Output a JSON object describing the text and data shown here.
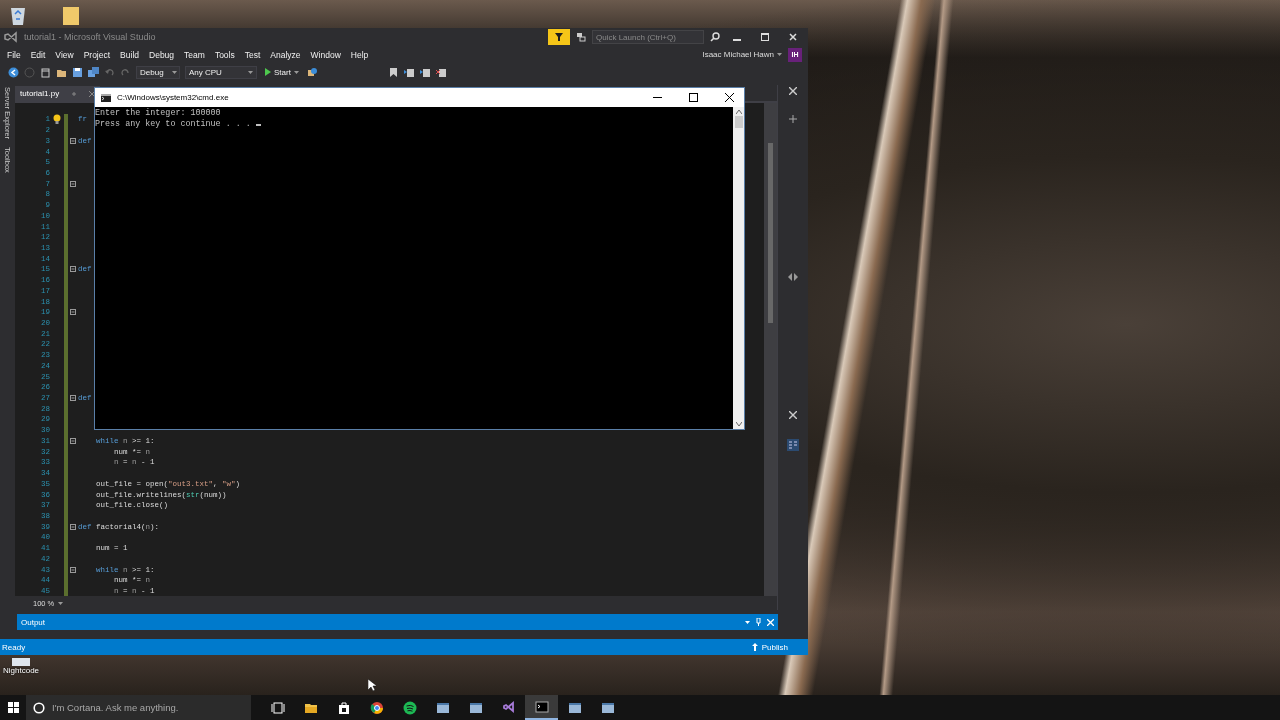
{
  "desktop_icons": [
    {
      "label": "Nightcode"
    }
  ],
  "vs": {
    "title": "tutorial1 - Microsoft Visual Studio",
    "quick_launch": {
      "placeholder": "Quick Launch (Ctrl+Q)"
    },
    "user": "Isaac Michael Hawn",
    "avatar": "IH",
    "menu": [
      "File",
      "Edit",
      "View",
      "Project",
      "Build",
      "Debug",
      "Team",
      "Tools",
      "Test",
      "Analyze",
      "Window",
      "Help"
    ],
    "toolbar": {
      "configuration": "Debug",
      "platform": "Any CPU",
      "start": "Start"
    },
    "side_tabs": [
      "Server Explorer",
      "Toolbox"
    ],
    "tabs": [
      {
        "label": "tutorial1.py",
        "selected": true
      }
    ],
    "code_lines": [
      {
        "n": "1",
        "fold": false,
        "segs": [
          {
            "kind": "kw",
            "text": "fr"
          }
        ]
      },
      {
        "n": "2",
        "fold": false
      },
      {
        "n": "3",
        "fold": true,
        "segs": [
          {
            "kind": "kw",
            "text": "def"
          }
        ]
      },
      {
        "n": "4",
        "fold": false
      },
      {
        "n": "5",
        "fold": false
      },
      {
        "n": "6",
        "fold": false
      },
      {
        "n": "7",
        "fold": true
      },
      {
        "n": "8",
        "fold": false
      },
      {
        "n": "9",
        "fold": false
      },
      {
        "n": "10",
        "fold": false
      },
      {
        "n": "11",
        "fold": false
      },
      {
        "n": "12",
        "fold": false
      },
      {
        "n": "13",
        "fold": false
      },
      {
        "n": "14",
        "fold": false
      },
      {
        "n": "15",
        "fold": true,
        "segs": [
          {
            "kind": "kw",
            "text": "def"
          }
        ]
      },
      {
        "n": "16",
        "fold": false
      },
      {
        "n": "17",
        "fold": false
      },
      {
        "n": "18",
        "fold": false
      },
      {
        "n": "19",
        "fold": true
      },
      {
        "n": "20",
        "fold": false
      },
      {
        "n": "21",
        "fold": false
      },
      {
        "n": "22",
        "fold": false
      },
      {
        "n": "23",
        "fold": false
      },
      {
        "n": "24",
        "fold": false
      },
      {
        "n": "25",
        "fold": false
      },
      {
        "n": "26",
        "fold": false
      },
      {
        "n": "27",
        "fold": true,
        "segs": [
          {
            "kind": "kw",
            "text": "def"
          }
        ]
      },
      {
        "n": "28",
        "fold": false
      },
      {
        "n": "29",
        "fold": false
      },
      {
        "n": "30",
        "fold": false
      },
      {
        "n": "31",
        "fold": true,
        "segs": [
          {
            "kind": "kw",
            "text": "    while"
          },
          {
            "kind": "param",
            "text": " n"
          },
          {
            "kind": "plain",
            "text": " >= 1:"
          }
        ]
      },
      {
        "n": "32",
        "fold": false,
        "segs": [
          {
            "kind": "plain",
            "text": "        num *= "
          },
          {
            "kind": "param",
            "text": "n"
          }
        ]
      },
      {
        "n": "33",
        "fold": false,
        "segs": [
          {
            "kind": "param",
            "text": "        n"
          },
          {
            "kind": "plain",
            "text": " = "
          },
          {
            "kind": "param",
            "text": "n"
          },
          {
            "kind": "plain",
            "text": " - 1"
          }
        ]
      },
      {
        "n": "34",
        "fold": false
      },
      {
        "n": "35",
        "fold": false,
        "segs": [
          {
            "kind": "plain",
            "text": "    out_file = open("
          },
          {
            "kind": "str",
            "text": "\"out3.txt\""
          },
          {
            "kind": "plain",
            "text": ", "
          },
          {
            "kind": "str",
            "text": "\"w\""
          },
          {
            "kind": "plain",
            "text": ")"
          }
        ]
      },
      {
        "n": "36",
        "fold": false,
        "segs": [
          {
            "kind": "plain",
            "text": "    out_file.writelines("
          },
          {
            "kind": "builtin",
            "text": "str"
          },
          {
            "kind": "plain",
            "text": "(num))"
          }
        ]
      },
      {
        "n": "37",
        "fold": false,
        "segs": [
          {
            "kind": "plain",
            "text": "    out_file.close()"
          }
        ]
      },
      {
        "n": "38",
        "fold": false
      },
      {
        "n": "39",
        "fold": true,
        "segs": [
          {
            "kind": "kw",
            "text": "def"
          },
          {
            "kind": "plain",
            "text": " factorial4("
          },
          {
            "kind": "param",
            "text": "n"
          },
          {
            "kind": "plain",
            "text": "):"
          }
        ]
      },
      {
        "n": "40",
        "fold": false
      },
      {
        "n": "41",
        "fold": false,
        "segs": [
          {
            "kind": "plain",
            "text": "    num = 1"
          }
        ]
      },
      {
        "n": "42",
        "fold": false
      },
      {
        "n": "43",
        "fold": true,
        "segs": [
          {
            "kind": "kw",
            "text": "    while"
          },
          {
            "kind": "param",
            "text": " n"
          },
          {
            "kind": "plain",
            "text": " >= 1:"
          }
        ]
      },
      {
        "n": "44",
        "fold": false,
        "segs": [
          {
            "kind": "plain",
            "text": "        num *= "
          },
          {
            "kind": "param",
            "text": "n"
          }
        ]
      },
      {
        "n": "45",
        "fold": false,
        "segs": [
          {
            "kind": "param",
            "text": "        n"
          },
          {
            "kind": "plain",
            "text": " = "
          },
          {
            "kind": "param",
            "text": "n"
          },
          {
            "kind": "plain",
            "text": " - 1"
          }
        ]
      }
    ],
    "zoom": "100 %",
    "output_title": "Output",
    "status": "Ready",
    "publish": "Publish"
  },
  "cmd": {
    "title": "C:\\Windows\\system32\\cmd.exe",
    "lines": [
      "Enter the integer: 100000",
      "Press any key to continue . . . "
    ]
  },
  "taskbar": {
    "search": {
      "placeholder": "I'm Cortana. Ask me anything."
    },
    "apps": [
      {
        "kind": "taskview",
        "selected": false
      },
      {
        "kind": "folder",
        "selected": false
      },
      {
        "kind": "store",
        "selected": false
      },
      {
        "kind": "browser",
        "selected": false
      },
      {
        "kind": "music",
        "selected": false
      },
      {
        "kind": "window",
        "selected": false
      },
      {
        "kind": "window",
        "selected": false
      },
      {
        "kind": "vs",
        "selected": false
      },
      {
        "kind": "terminal",
        "selected": true
      },
      {
        "kind": "window",
        "selected": false
      },
      {
        "kind": "window",
        "selected": false
      }
    ]
  }
}
